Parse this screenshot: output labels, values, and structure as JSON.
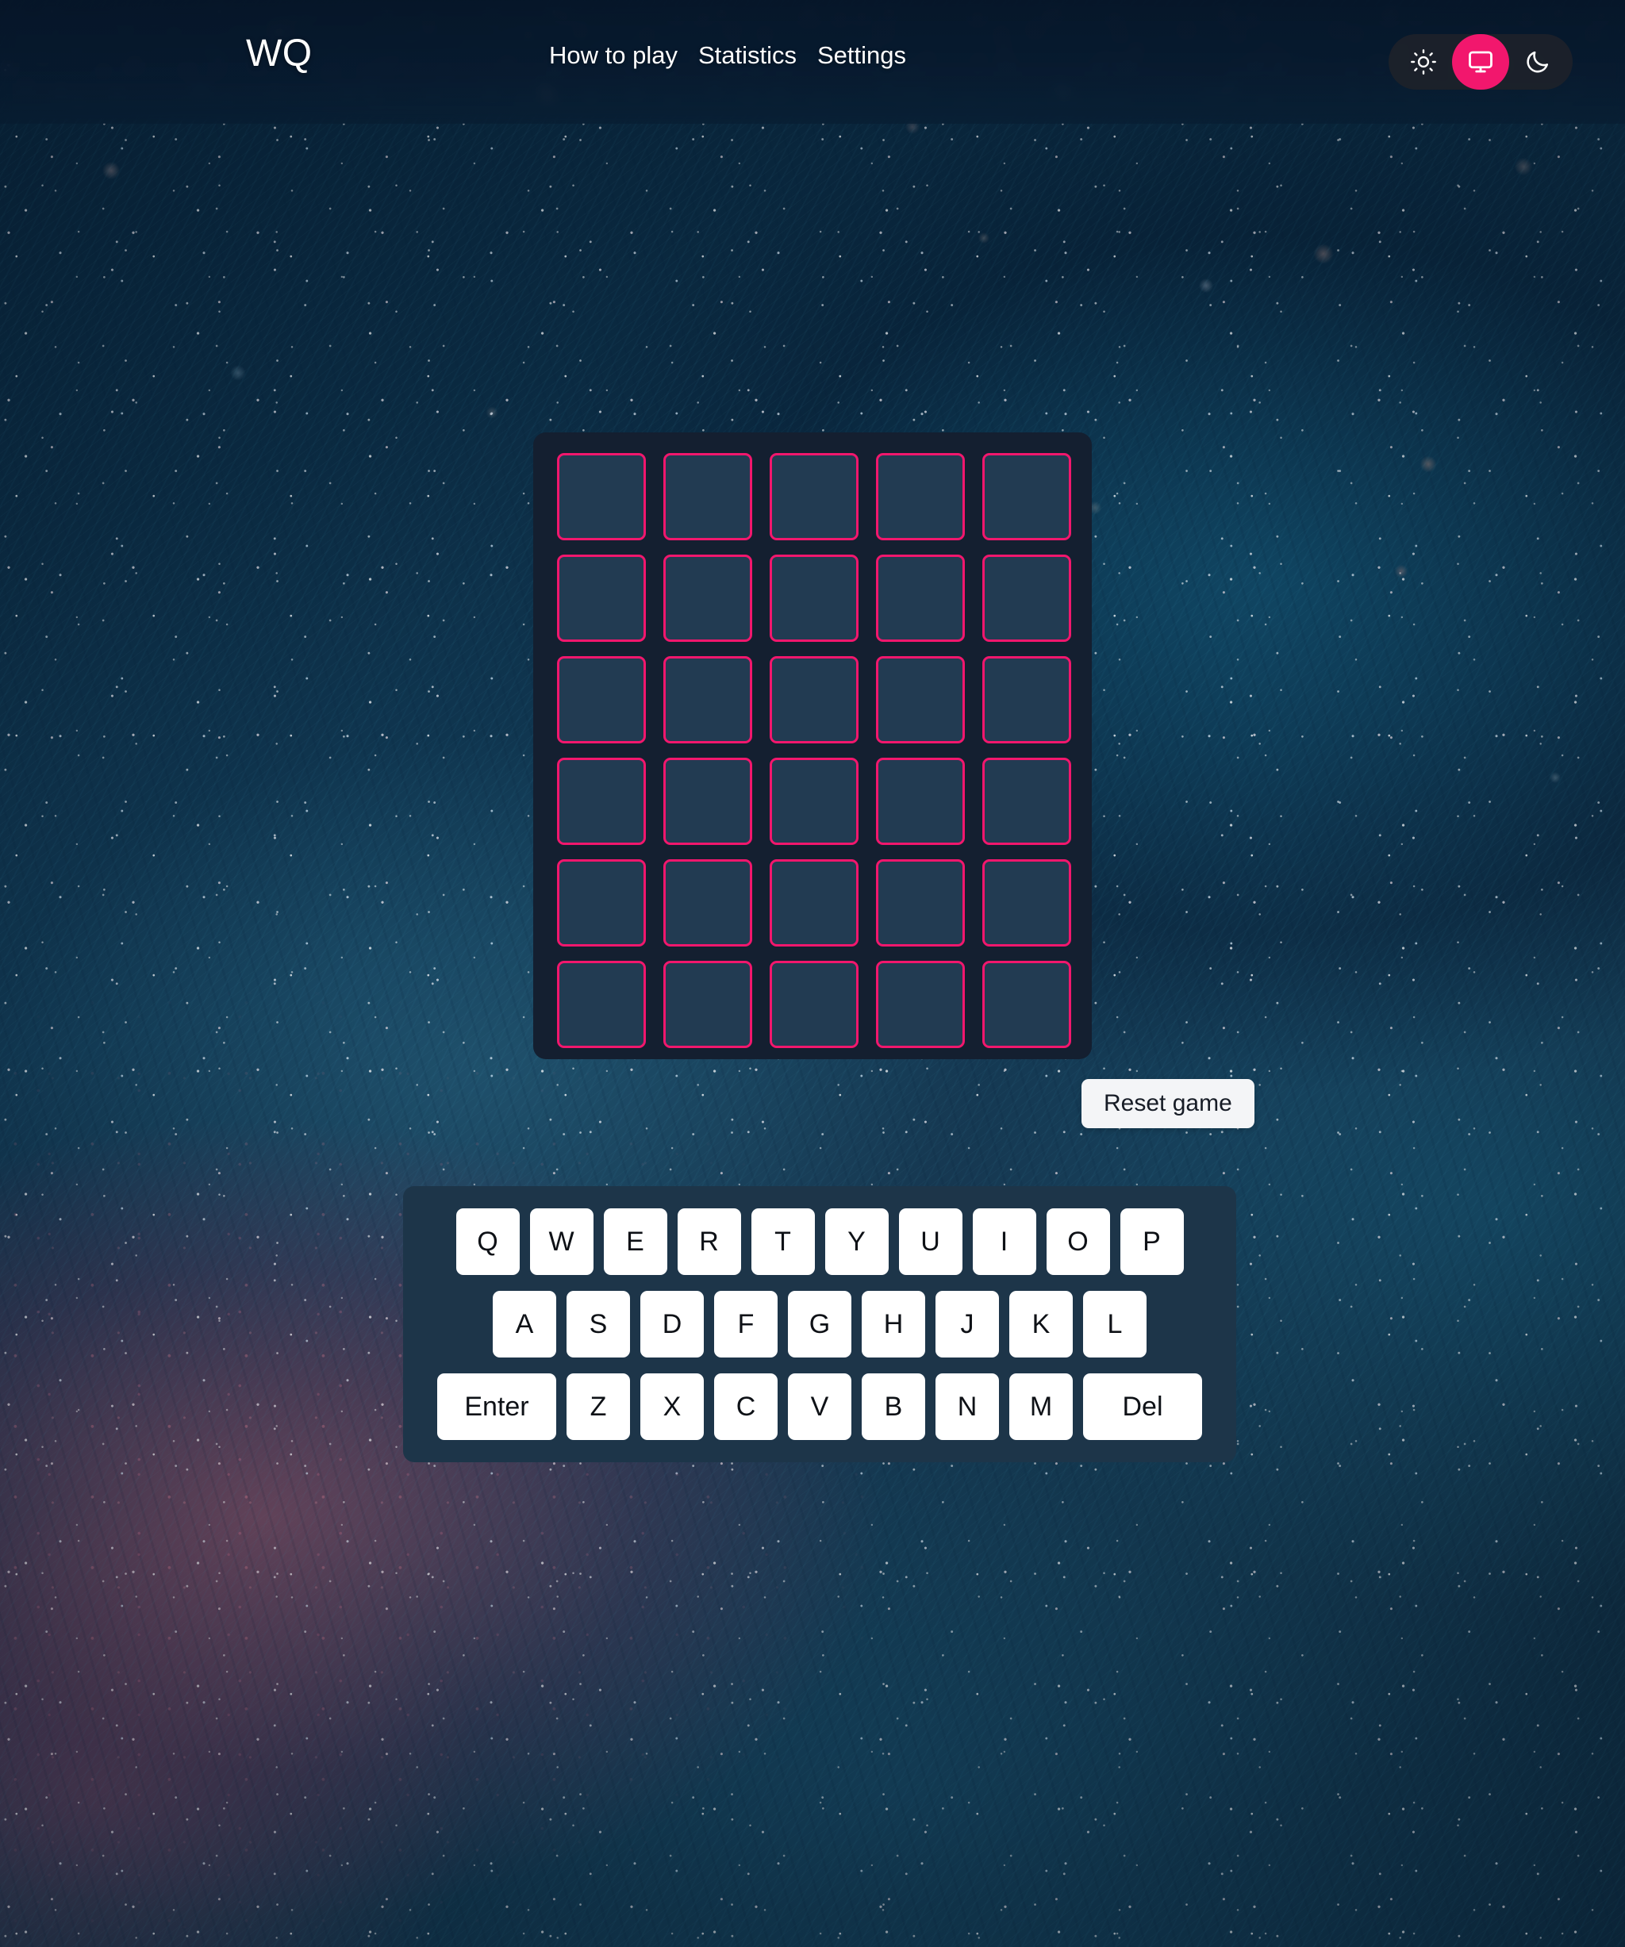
{
  "header": {
    "logo": "WQ",
    "nav": [
      {
        "label": "How to play",
        "name": "nav-how-to-play"
      },
      {
        "label": "Statistics",
        "name": "nav-statistics"
      },
      {
        "label": "Settings",
        "name": "nav-settings"
      }
    ],
    "theme_switch": {
      "options": [
        {
          "icon": "sun-icon",
          "label": "Light",
          "active": false
        },
        {
          "icon": "display-icon",
          "label": "System",
          "active": true
        },
        {
          "icon": "moon-icon",
          "label": "Dark",
          "active": false
        }
      ],
      "active_color": "#f2176d",
      "track_color": "#1d212a"
    }
  },
  "board": {
    "rows": 6,
    "columns": 5,
    "tile_border_color": "#f2176d",
    "tile_fill_color": "#223b52",
    "panel_color": "#141f30",
    "cells": [
      [
        "",
        "",
        "",
        "",
        ""
      ],
      [
        "",
        "",
        "",
        "",
        ""
      ],
      [
        "",
        "",
        "",
        "",
        ""
      ],
      [
        "",
        "",
        "",
        "",
        ""
      ],
      [
        "",
        "",
        "",
        "",
        ""
      ],
      [
        "",
        "",
        "",
        "",
        ""
      ]
    ]
  },
  "reset": {
    "label": "Reset game"
  },
  "keyboard": {
    "panel_color": "#1d3549",
    "key_color": "#ffffff",
    "key_text_color": "#0e1116",
    "rows": [
      [
        {
          "label": "Q",
          "wide": false
        },
        {
          "label": "W",
          "wide": false
        },
        {
          "label": "E",
          "wide": false
        },
        {
          "label": "R",
          "wide": false
        },
        {
          "label": "T",
          "wide": false
        },
        {
          "label": "Y",
          "wide": false
        },
        {
          "label": "U",
          "wide": false
        },
        {
          "label": "I",
          "wide": false
        },
        {
          "label": "O",
          "wide": false
        },
        {
          "label": "P",
          "wide": false
        }
      ],
      [
        {
          "label": "A",
          "wide": false
        },
        {
          "label": "S",
          "wide": false
        },
        {
          "label": "D",
          "wide": false
        },
        {
          "label": "F",
          "wide": false
        },
        {
          "label": "G",
          "wide": false
        },
        {
          "label": "H",
          "wide": false
        },
        {
          "label": "J",
          "wide": false
        },
        {
          "label": "K",
          "wide": false
        },
        {
          "label": "L",
          "wide": false
        }
      ],
      [
        {
          "label": "Enter",
          "wide": true
        },
        {
          "label": "Z",
          "wide": false
        },
        {
          "label": "X",
          "wide": false
        },
        {
          "label": "C",
          "wide": false
        },
        {
          "label": "V",
          "wide": false
        },
        {
          "label": "B",
          "wide": false
        },
        {
          "label": "N",
          "wide": false
        },
        {
          "label": "M",
          "wide": false
        },
        {
          "label": "Del",
          "wide": true
        }
      ]
    ]
  }
}
